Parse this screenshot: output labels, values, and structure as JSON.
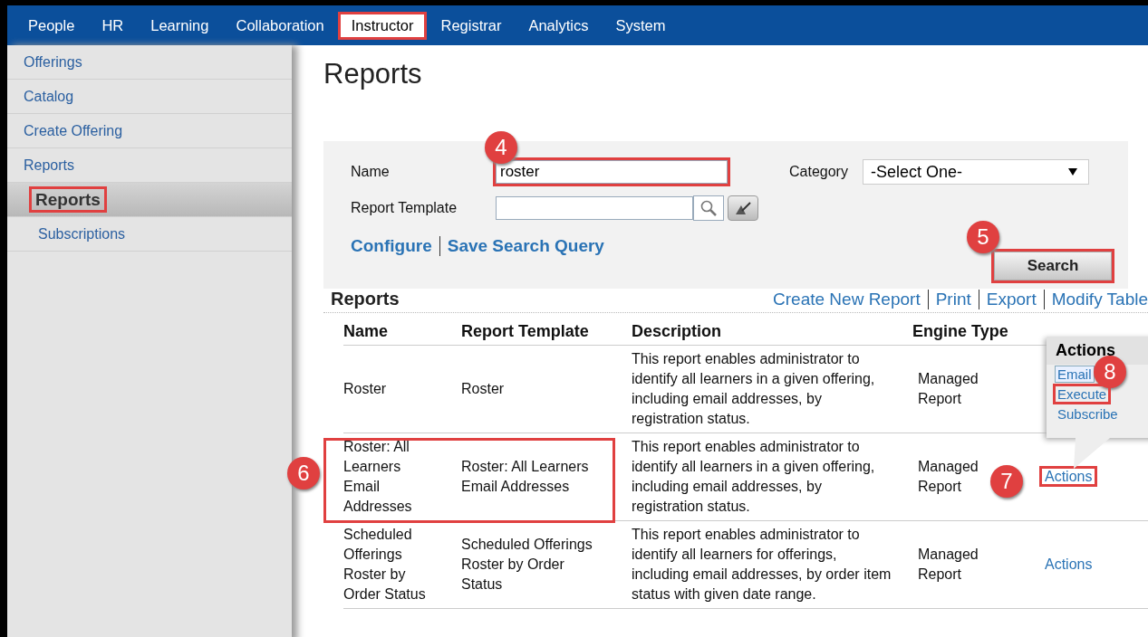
{
  "nav": {
    "tabs": [
      {
        "label": "People",
        "selected": false,
        "highlighted": false
      },
      {
        "label": "HR",
        "selected": false,
        "highlighted": false
      },
      {
        "label": "Learning",
        "selected": false,
        "highlighted": false
      },
      {
        "label": "Collaboration",
        "selected": false,
        "highlighted": false
      },
      {
        "label": "Instructor",
        "selected": true,
        "highlighted": true
      },
      {
        "label": "Registrar",
        "selected": false,
        "highlighted": false
      },
      {
        "label": "Analytics",
        "selected": false,
        "highlighted": false
      },
      {
        "label": "System",
        "selected": false,
        "highlighted": false
      }
    ]
  },
  "sidebar": {
    "items": [
      {
        "label": "Offerings",
        "selected": false,
        "highlighted": false
      },
      {
        "label": "Catalog",
        "selected": false,
        "highlighted": false
      },
      {
        "label": "Create Offering",
        "selected": false,
        "highlighted": false
      },
      {
        "label": "Reports",
        "selected": false,
        "highlighted": false,
        "children": [
          {
            "label": "Reports",
            "selected": true,
            "highlighted": true
          },
          {
            "label": "Subscriptions",
            "selected": false,
            "highlighted": false
          }
        ]
      }
    ]
  },
  "page_title": "Reports",
  "search_form": {
    "name": {
      "label": "Name",
      "value": "roster",
      "highlighted": true,
      "callout": "4"
    },
    "category": {
      "label": "Category",
      "value": "-Select One-"
    },
    "report_template": {
      "label": "Report Template"
    },
    "links": [
      "Configure",
      "Save Search Query"
    ],
    "search_button": {
      "label": "Search",
      "highlighted": true,
      "callout": "5"
    }
  },
  "results": {
    "title": "Reports",
    "links": [
      "Create New Report",
      "Print",
      "Export",
      "Modify Table"
    ],
    "columns": [
      "Name",
      "Report Template",
      "Description",
      "Engine Type"
    ],
    "rows": [
      {
        "name": "Roster",
        "template": "Roster",
        "description": "This report enables administrator to identify all learners in a given offering, including email addresses, by registration status.",
        "engine": "Managed Report",
        "highlighted": false
      },
      {
        "name": "Roster: All Learners Email Addresses",
        "template": "Roster: All Learners Email Addresses",
        "description": "This report enables administrator to identify all learners in a given offering, including email addresses, by registration status.",
        "engine": "Managed Report",
        "highlighted": true,
        "callout": "6",
        "action": {
          "label": "Actions",
          "highlighted": true,
          "callout": "7"
        }
      },
      {
        "name": "Scheduled Offerings Roster by Order Status",
        "template": "Scheduled Offerings Roster by Order Status",
        "description": "This report enables administrator to identify all learners for offerings, including email addresses, by order item status with given date range.",
        "engine": "Managed Report",
        "highlighted": false,
        "action": {
          "label": "Actions",
          "highlighted": false
        }
      }
    ]
  },
  "actions_popup": {
    "title": "Actions",
    "items": [
      {
        "label": "Email",
        "focused": true,
        "highlighted": false,
        "callout": "8"
      },
      {
        "label": "Execute",
        "focused": false,
        "highlighted": true
      },
      {
        "label": "Subscribe",
        "focused": false,
        "highlighted": false
      }
    ]
  }
}
